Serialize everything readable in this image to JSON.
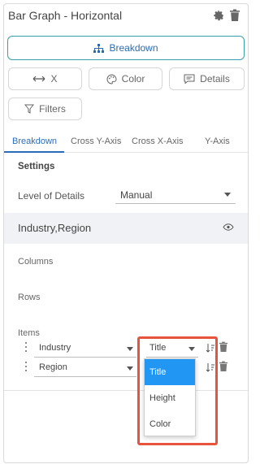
{
  "header": {
    "title": "Bar Graph - Horizontal",
    "settings_icon": "gear-icon",
    "delete_icon": "trash-icon"
  },
  "breakdown_button": {
    "label": "Breakdown",
    "icon": "hierarchy-icon"
  },
  "pills": {
    "x": {
      "label": "X",
      "icon": "horizontal-arrows-icon"
    },
    "color": {
      "label": "Color",
      "icon": "palette-icon"
    },
    "details": {
      "label": "Details",
      "icon": "comment-icon"
    },
    "filters": {
      "label": "Filters",
      "icon": "filter-icon"
    }
  },
  "tabs": [
    "Breakdown",
    "Cross Y-Axis",
    "Cross X-Axis",
    "Y-Axis"
  ],
  "active_tab": "Breakdown",
  "settings": {
    "heading": "Settings",
    "level_of_details": {
      "label": "Level of Details",
      "value": "Manual"
    }
  },
  "breakdown_row": {
    "name": "Industry,Region",
    "icon": "eye-icon"
  },
  "sections": {
    "columns": "Columns",
    "rows": "Rows",
    "items": "Items"
  },
  "items": [
    {
      "field": "Industry",
      "role": "Title"
    },
    {
      "field": "Region",
      "role": ""
    }
  ],
  "role_dropdown": {
    "options": [
      "Title",
      "Height",
      "Color"
    ],
    "selected": "Title"
  },
  "colors": {
    "accent": "#2a6ebb",
    "highlight": "#e8533d",
    "selected_option": "#2196f3",
    "breakdown_border": "#36a0a8"
  }
}
